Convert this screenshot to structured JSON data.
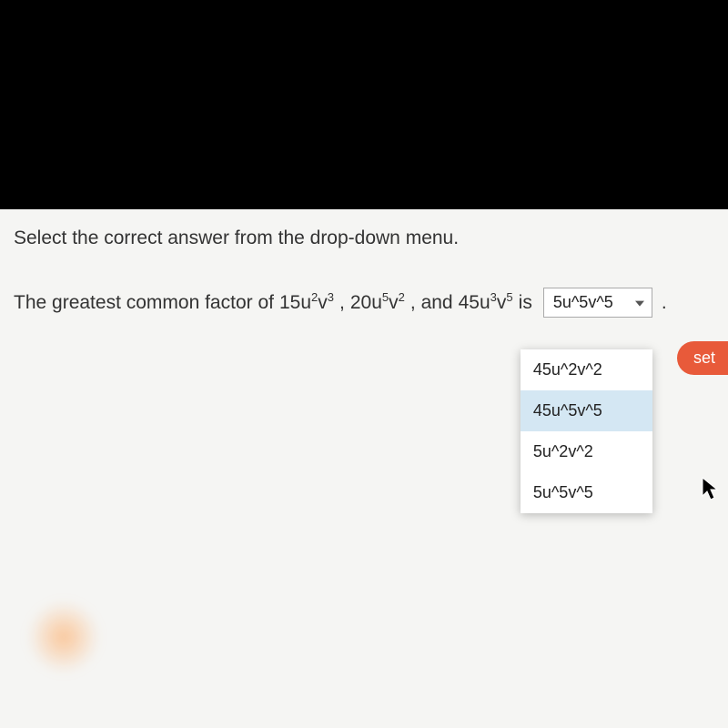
{
  "instruction": "Select the correct answer from the drop-down menu.",
  "question_prefix": "The greatest common factor of ",
  "terms": {
    "t1_coef": "15",
    "t1_var1": "u",
    "t1_exp1": "2",
    "t1_var2": "v",
    "t1_exp2": "3",
    "sep1": ", ",
    "t2_coef": "20",
    "t2_var1": "u",
    "t2_exp1": "5",
    "t2_var2": "v",
    "t2_exp2": "2",
    "sep2": ", and ",
    "t3_coef": "45",
    "t3_var1": "u",
    "t3_exp1": "3",
    "t3_var2": "v",
    "t3_exp2": "5",
    "suffix": " is"
  },
  "dropdown": {
    "selected": "5u^5v^5",
    "options": [
      {
        "label": "45u^2v^2",
        "highlighted": false
      },
      {
        "label": "45u^5v^5",
        "highlighted": true
      },
      {
        "label": "5u^2v^2",
        "highlighted": false
      },
      {
        "label": "5u^5v^5",
        "highlighted": false
      }
    ]
  },
  "button": {
    "set": "set"
  },
  "period": "."
}
